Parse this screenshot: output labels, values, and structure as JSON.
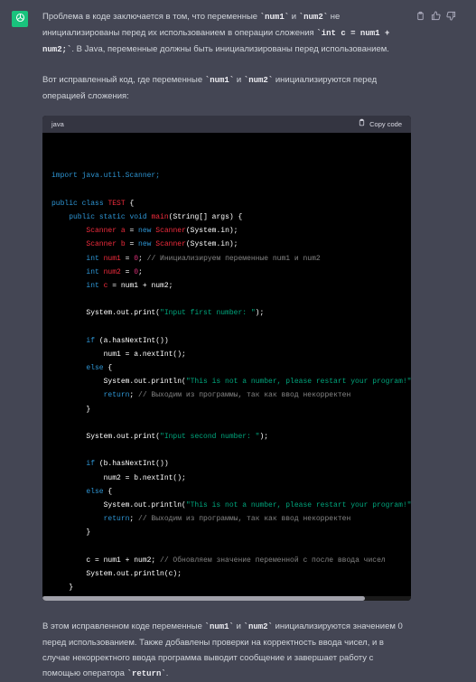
{
  "message": {
    "p1": [
      "Проблема в коде заключается в том, что переменные ",
      "`num1`",
      " и ",
      "`num2`",
      " не инициализированы перед их использованием в операции сложения ",
      "`int c = num1 + num2;`",
      ". В Java, переменные должны быть инициализированы перед использованием."
    ],
    "p2": [
      "Вот исправленный код, где переменные ",
      "`num1`",
      " и ",
      "`num2`",
      " инициализируются перед операцией сложения:"
    ],
    "p3": [
      "В этом исправленном коде переменные ",
      "`num1`",
      " и ",
      "`num2`",
      " инициализируются значением 0 перед использованием. Также добавлены проверки на корректность ввода чисел, и в случае некорректного ввода программа выводит сообщение и завершает работу с помощью оператора ",
      "`return`",
      "."
    ]
  },
  "codeblock": {
    "language": "java",
    "copy_label": "Copy code",
    "scroll_fraction": 0.875,
    "lines": [
      [
        [
          "import java.util.Scanner;",
          "k"
        ]
      ],
      [],
      [
        [
          "public",
          "k"
        ],
        [
          " ",
          ""
        ],
        [
          "class",
          "k"
        ],
        [
          " ",
          ""
        ],
        [
          "TEST",
          "t"
        ],
        [
          " {",
          ""
        ]
      ],
      [
        [
          "    ",
          ""
        ],
        [
          "public",
          "k"
        ],
        [
          " ",
          ""
        ],
        [
          "static",
          "k"
        ],
        [
          " ",
          ""
        ],
        [
          "void",
          "k"
        ],
        [
          " ",
          ""
        ],
        [
          "main",
          "t"
        ],
        [
          "(String[] args) {",
          ""
        ]
      ],
      [
        [
          "        ",
          ""
        ],
        [
          "Scanner",
          "t"
        ],
        [
          " ",
          ""
        ],
        [
          "a",
          "t"
        ],
        [
          " = ",
          ""
        ],
        [
          "new",
          "k"
        ],
        [
          " ",
          ""
        ],
        [
          "Scanner",
          "t"
        ],
        [
          "(System.in);",
          ""
        ]
      ],
      [
        [
          "        ",
          ""
        ],
        [
          "Scanner",
          "t"
        ],
        [
          " ",
          ""
        ],
        [
          "b",
          "t"
        ],
        [
          " = ",
          ""
        ],
        [
          "new",
          "k"
        ],
        [
          " ",
          ""
        ],
        [
          "Scanner",
          "t"
        ],
        [
          "(System.in);",
          ""
        ]
      ],
      [
        [
          "        ",
          ""
        ],
        [
          "int",
          "k"
        ],
        [
          " ",
          ""
        ],
        [
          "num1",
          "t"
        ],
        [
          " = ",
          ""
        ],
        [
          "0",
          "n"
        ],
        [
          "; ",
          ""
        ],
        [
          "// Инициализируем переменные num1 и num2",
          "c"
        ]
      ],
      [
        [
          "        ",
          ""
        ],
        [
          "int",
          "k"
        ],
        [
          " ",
          ""
        ],
        [
          "num2",
          "t"
        ],
        [
          " = ",
          ""
        ],
        [
          "0",
          "n"
        ],
        [
          ";",
          ""
        ]
      ],
      [
        [
          "        ",
          ""
        ],
        [
          "int",
          "k"
        ],
        [
          " ",
          ""
        ],
        [
          "c",
          "t"
        ],
        [
          " = num1 + num2;",
          ""
        ]
      ],
      [],
      [
        [
          "        System.out.print(",
          ""
        ],
        [
          "\"Input first number: \"",
          "s"
        ],
        [
          ");",
          ""
        ]
      ],
      [],
      [
        [
          "        ",
          ""
        ],
        [
          "if",
          "k"
        ],
        [
          " (a.hasNextInt())",
          ""
        ]
      ],
      [
        [
          "            num1 = a.nextInt();",
          ""
        ]
      ],
      [
        [
          "        ",
          ""
        ],
        [
          "else",
          "k"
        ],
        [
          " {",
          ""
        ]
      ],
      [
        [
          "            System.out.println(",
          ""
        ],
        [
          "\"This is not a number, please restart your program!\"",
          "s"
        ],
        [
          ");",
          ""
        ]
      ],
      [
        [
          "            ",
          ""
        ],
        [
          "return",
          "k"
        ],
        [
          "; ",
          ""
        ],
        [
          "// Выходим из программы, так как ввод некорректен",
          "c"
        ]
      ],
      [
        [
          "        }",
          ""
        ]
      ],
      [],
      [
        [
          "        System.out.print(",
          ""
        ],
        [
          "\"Input second number: \"",
          "s"
        ],
        [
          ");",
          ""
        ]
      ],
      [],
      [
        [
          "        ",
          ""
        ],
        [
          "if",
          "k"
        ],
        [
          " (b.hasNextInt())",
          ""
        ]
      ],
      [
        [
          "            num2 = b.nextInt();",
          ""
        ]
      ],
      [
        [
          "        ",
          ""
        ],
        [
          "else",
          "k"
        ],
        [
          " {",
          ""
        ]
      ],
      [
        [
          "            System.out.println(",
          ""
        ],
        [
          "\"This is not a number, please restart your program!\"",
          "s"
        ],
        [
          ");",
          ""
        ]
      ],
      [
        [
          "            ",
          ""
        ],
        [
          "return",
          "k"
        ],
        [
          "; ",
          ""
        ],
        [
          "// Выходим из программы, так как ввод некорректен",
          "c"
        ]
      ],
      [
        [
          "        }",
          ""
        ]
      ],
      [],
      [
        [
          "        c = num1 + num2; ",
          ""
        ],
        [
          "// Обновляем значение переменной c после ввода чисел",
          "c"
        ]
      ],
      [
        [
          "        System.out.println(c);",
          ""
        ]
      ],
      [
        [
          "    }",
          ""
        ]
      ],
      [
        [
          "}",
          ""
        ]
      ]
    ]
  },
  "icons": {
    "avatar": "openai-logo-icon",
    "copy": "clipboard-icon",
    "message_copy": "clipboard-icon",
    "thumbs_up": "thumbs-up-icon",
    "thumbs_down": "thumbs-down-icon"
  },
  "colors": {
    "background": "#444654",
    "avatar": "#19c37d",
    "code_bg": "#000000",
    "code_header": "#343541"
  }
}
